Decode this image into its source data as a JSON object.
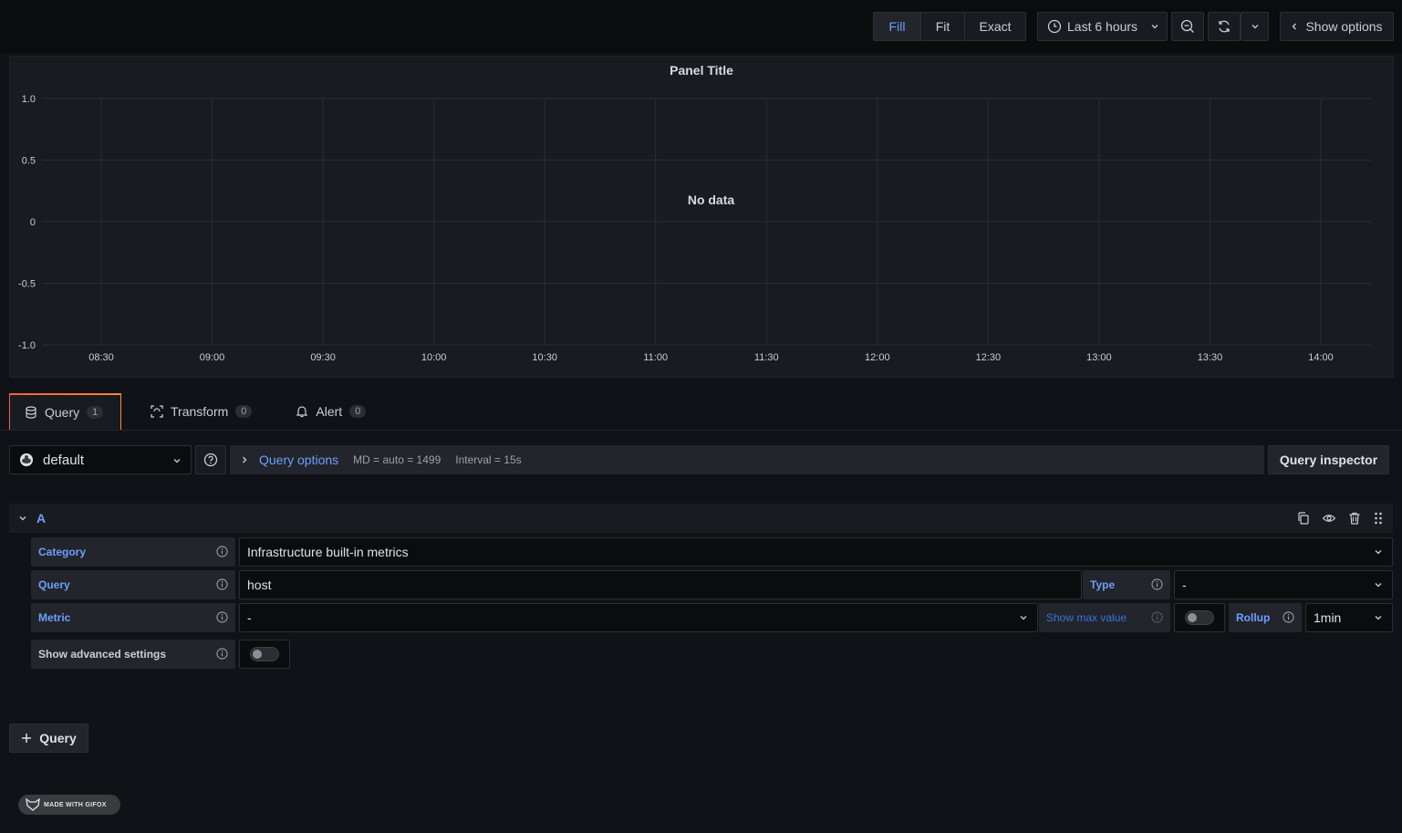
{
  "toolbar": {
    "zoom_modes": [
      {
        "label": "Fill",
        "active": true
      },
      {
        "label": "Fit",
        "active": false
      },
      {
        "label": "Exact",
        "active": false
      }
    ],
    "time_range": "Last 6 hours",
    "show_options": "Show options"
  },
  "panel": {
    "title": "Panel Title",
    "no_data": "No data"
  },
  "chart_data": {
    "type": "line",
    "title": "Panel Title",
    "series": [],
    "x_ticks": [
      "08:30",
      "09:00",
      "09:30",
      "10:00",
      "10:30",
      "11:00",
      "11:30",
      "12:00",
      "12:30",
      "13:00",
      "13:30",
      "14:00"
    ],
    "y_ticks": [
      "1.0",
      "0.5",
      "0",
      "-0.5",
      "-1.0"
    ],
    "ylim": [
      -1.0,
      1.0
    ],
    "grid": true,
    "annotation": "No data"
  },
  "tabs": [
    {
      "label": "Query",
      "count": "1",
      "icon": "database-icon",
      "active": true
    },
    {
      "label": "Transform",
      "count": "0",
      "icon": "transform-icon",
      "active": false
    },
    {
      "label": "Alert",
      "count": "0",
      "icon": "bell-icon",
      "active": false
    }
  ],
  "datasource": {
    "value": "default"
  },
  "query_options": {
    "label": "Query options",
    "md": "MD = auto = 1499",
    "interval": "Interval = 15s"
  },
  "query_inspector": "Query inspector",
  "query_row": {
    "ref": "A",
    "category_label": "Category",
    "category_value": "Infrastructure built-in metrics",
    "query_label": "Query",
    "query_value": "host",
    "type_label": "Type",
    "type_value": "-",
    "metric_label": "Metric",
    "metric_value": "-",
    "show_max_label": "Show max value",
    "rollup_label": "Rollup",
    "rollup_value": "1min",
    "advanced_label": "Show advanced settings"
  },
  "add_query": "Query",
  "watermark": "MADE WITH GIFOX",
  "colors": {
    "accent": "#6e9fff",
    "background": "#111217",
    "panel": "#181b1f"
  }
}
